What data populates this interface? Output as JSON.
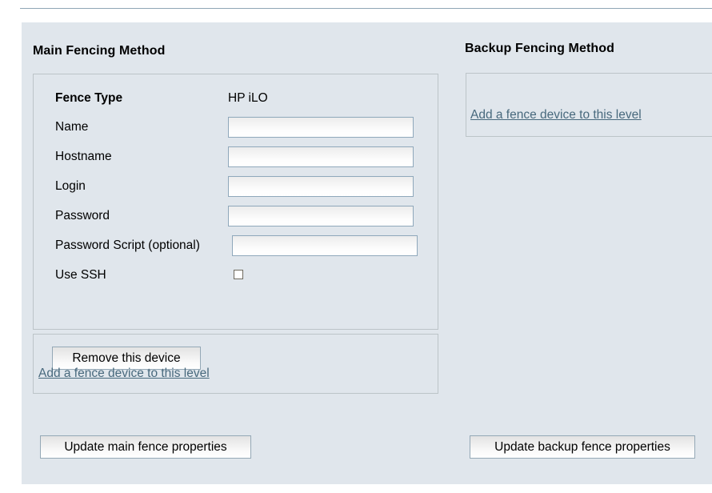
{
  "page": {
    "divider": "horizontal-rule"
  },
  "main_column": {
    "title": "Main Fencing Method",
    "device": {
      "fields": [
        {
          "label": "Fence Type",
          "type": "static",
          "value": "HP iLO",
          "bold": true
        },
        {
          "label": "Name",
          "type": "text",
          "value": "",
          "placeholder": ""
        },
        {
          "label": "Hostname",
          "type": "text",
          "value": "",
          "placeholder": ""
        },
        {
          "label": "Login",
          "type": "text",
          "value": "",
          "placeholder": ""
        },
        {
          "label": "Password",
          "type": "text",
          "value": "",
          "placeholder": ""
        },
        {
          "label": "Password Script (optional)",
          "type": "text",
          "value": "",
          "placeholder": ""
        },
        {
          "label": "Use SSH",
          "type": "checkbox",
          "checked": false
        }
      ],
      "remove_button": "Remove this device"
    },
    "add_device_link": "Add a fence device to this level",
    "update_button": "Update main fence properties"
  },
  "backup_column": {
    "title": "Backup Fencing Method",
    "add_device_link": "Add a fence device to this level",
    "update_button": "Update backup fence properties"
  },
  "colors": {
    "panel_background": "#e0e6ec",
    "box_border": "#bcc4c8",
    "input_border": "#8fa8bb",
    "link": "#48697d",
    "rule": "#8fa6b5",
    "text": "#000000"
  }
}
